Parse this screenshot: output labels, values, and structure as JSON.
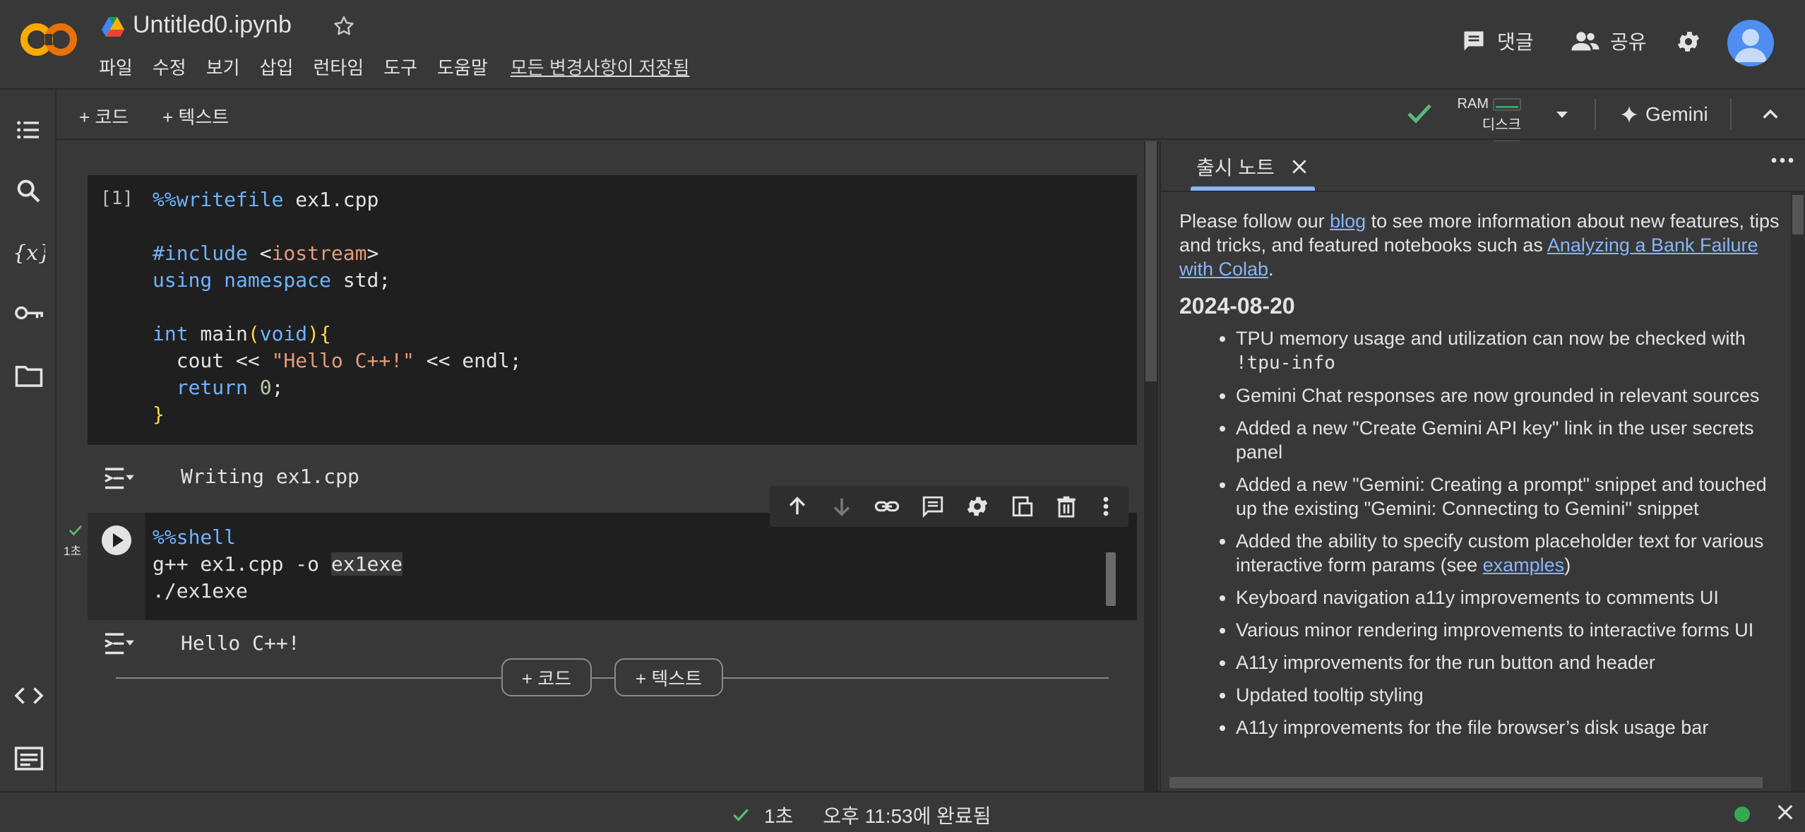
{
  "header": {
    "file_title": "Untitled0.ipynb",
    "menu": [
      "파일",
      "수정",
      "보기",
      "삽입",
      "런타임",
      "도구",
      "도움말"
    ],
    "saved_status": "모든 변경사항이 저장됨",
    "comments_label": "댓글",
    "share_label": "공유"
  },
  "toolbar": {
    "add_code_label": "+ 코드",
    "add_text_label": "+ 텍스트",
    "ram_label": "RAM",
    "disk_label": "디스크",
    "gemini_label": "Gemini"
  },
  "cells": [
    {
      "exec_count": "[1]",
      "output_text": "Writing ex1.cpp"
    },
    {
      "check_time": "1초",
      "output_text": "Hello C++!"
    }
  ],
  "add_pills": {
    "code": "+ 코드",
    "text": "+ 텍스트"
  },
  "panel": {
    "tab_title": "출시 노트",
    "intro_before_blog": "Please follow our ",
    "blog_link": "blog",
    "intro_middle": " to see more information about new features, tips and tricks, and featured notebooks such as ",
    "notebook_link": "Analyzing a Bank Failure with Colab",
    "intro_end": ".",
    "date": "2024-08-20",
    "notes": [
      "TPU memory usage and utilization can now be checked with",
      "Gemini Chat responses are now grounded in relevant sources",
      "Added a new \"Create Gemini API key\" link in the user secrets panel",
      "Added a new \"Gemini: Creating a prompt\" snippet and touched up the existing \"Gemini: Connecting to Gemini\" snippet",
      "Added the ability to specify custom placeholder text for various interactive form params (see ",
      "Keyboard navigation a11y improvements to comments UI",
      "Various minor rendering improvements to interactive forms UI",
      "A11y improvements for the run button and header",
      "Updated tooltip styling",
      "A11y improvements for the file browser’s disk usage bar"
    ],
    "tpu_code": "!tpu-info",
    "examples_link": "examples",
    "examples_close": ")"
  },
  "status": {
    "time_spent": "1초",
    "completed": "오후 11:53에 완료됨"
  },
  "colors": {
    "background": "#383838",
    "code_bg": "#1f1f1f",
    "link": "#8ab4f8",
    "accent_blue": "#4d8ef0",
    "status_green": "#34a853",
    "logo_orange": "#f9ab00"
  }
}
